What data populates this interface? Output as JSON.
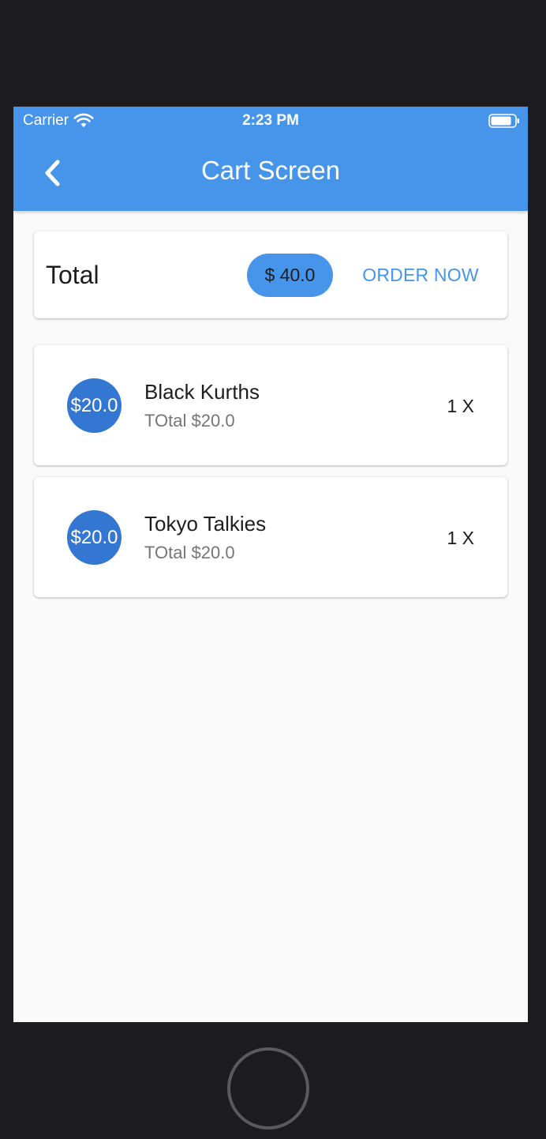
{
  "status_bar": {
    "carrier": "Carrier",
    "time": "2:23 PM",
    "wifi_icon": "wifi-icon",
    "battery_icon": "battery-icon"
  },
  "app_bar": {
    "title": "Cart Screen",
    "back_icon": "chevron-left-icon",
    "color": "#4795ea"
  },
  "summary": {
    "label": "Total",
    "amount": "$ 40.0",
    "order_button": "ORDER NOW"
  },
  "cart_items": [
    {
      "avatar_text": "$20.0",
      "name": "Black Kurths",
      "subtitle": "TOtal $20.0",
      "quantity": "1 X"
    },
    {
      "avatar_text": "$20.0",
      "name": "Tokyo Talkies",
      "subtitle": "TOtal $20.0",
      "quantity": "1 X"
    }
  ],
  "colors": {
    "accent": "#4795ea",
    "avatar": "#3477d2",
    "background": "#fafafa",
    "device_frame": "#1c1c1e"
  }
}
